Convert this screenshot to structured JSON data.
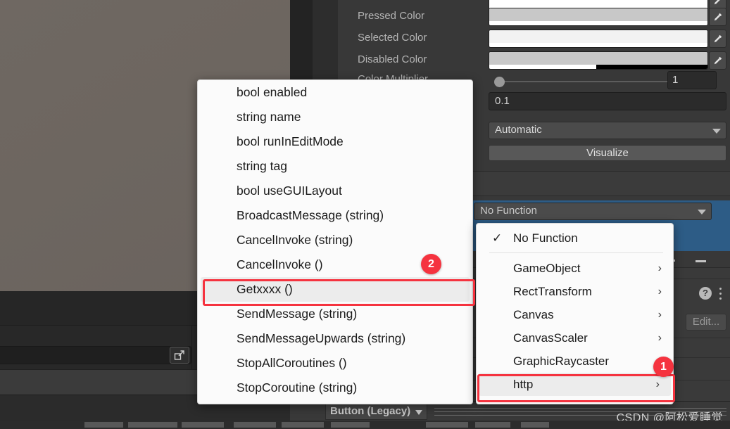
{
  "inspector": {
    "color_rows": [
      {
        "label": "Pressed Color"
      },
      {
        "label": "Selected Color"
      },
      {
        "label": "Disabled Color"
      },
      {
        "label": "Color Multiplier"
      }
    ],
    "color_multiplier_value": "1",
    "fade_duration_value": "0.1",
    "navigation_value": "Automatic",
    "visualize_label": "Visualize",
    "event_function_value": "No Function",
    "edit_label": "Edit...",
    "help_glyph": "?",
    "legacy_component": "Button (Legacy)"
  },
  "left_menu": {
    "items": [
      {
        "label": "bool enabled",
        "highlighted": false
      },
      {
        "label": "string name",
        "highlighted": false
      },
      {
        "label": "bool runInEditMode",
        "highlighted": false
      },
      {
        "label": "string tag",
        "highlighted": false
      },
      {
        "label": "bool useGUILayout",
        "highlighted": false
      },
      {
        "label": "BroadcastMessage (string)",
        "highlighted": false
      },
      {
        "label": "CancelInvoke (string)",
        "highlighted": false
      },
      {
        "label": "CancelInvoke ()",
        "highlighted": false
      },
      {
        "label": "Getxxxx ()",
        "highlighted": true
      },
      {
        "label": "SendMessage (string)",
        "highlighted": false
      },
      {
        "label": "SendMessageUpwards (string)",
        "highlighted": false
      },
      {
        "label": "StopAllCoroutines ()",
        "highlighted": false
      },
      {
        "label": "StopCoroutine (string)",
        "highlighted": false
      }
    ]
  },
  "right_menu": {
    "items": [
      {
        "label": "No Function",
        "checked": true,
        "submenu": false,
        "highlighted": false
      },
      {
        "label": "GameObject",
        "checked": false,
        "submenu": true,
        "highlighted": false
      },
      {
        "label": "RectTransform",
        "checked": false,
        "submenu": true,
        "highlighted": false
      },
      {
        "label": "Canvas",
        "checked": false,
        "submenu": true,
        "highlighted": false
      },
      {
        "label": "CanvasScaler",
        "checked": false,
        "submenu": true,
        "highlighted": false
      },
      {
        "label": "GraphicRaycaster",
        "checked": false,
        "submenu": true,
        "highlighted": false
      },
      {
        "label": "http",
        "checked": false,
        "submenu": true,
        "highlighted": true
      }
    ],
    "check_glyph": "✓",
    "chevron_glyph": "›"
  },
  "annotations": {
    "badge_one": "1",
    "badge_two": "2"
  },
  "watermark": "CSDN @阿松爱睡觉",
  "colors": {
    "accent_red": "#f5333f",
    "selection_blue": "#2d5c86",
    "panel_bg": "#383838",
    "menu_bg": "#fbfbfb"
  }
}
